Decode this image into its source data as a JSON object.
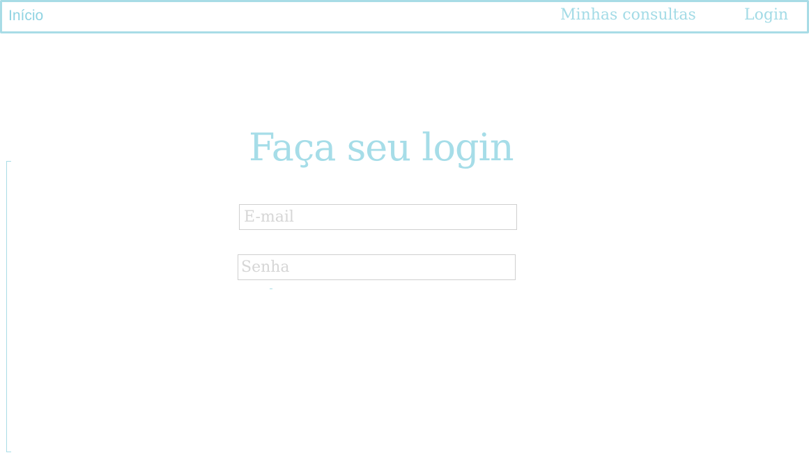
{
  "nav": {
    "home_label": "Início",
    "consultas_label": "Minhas consultas",
    "login_label": "Login"
  },
  "login": {
    "title": "Faça seu login",
    "email_placeholder": "E-mail",
    "password_placeholder": "Senha"
  },
  "colors": {
    "accent": "#a8dce6",
    "input_border": "#cfcfcf",
    "placeholder": "#d6d6d6"
  }
}
